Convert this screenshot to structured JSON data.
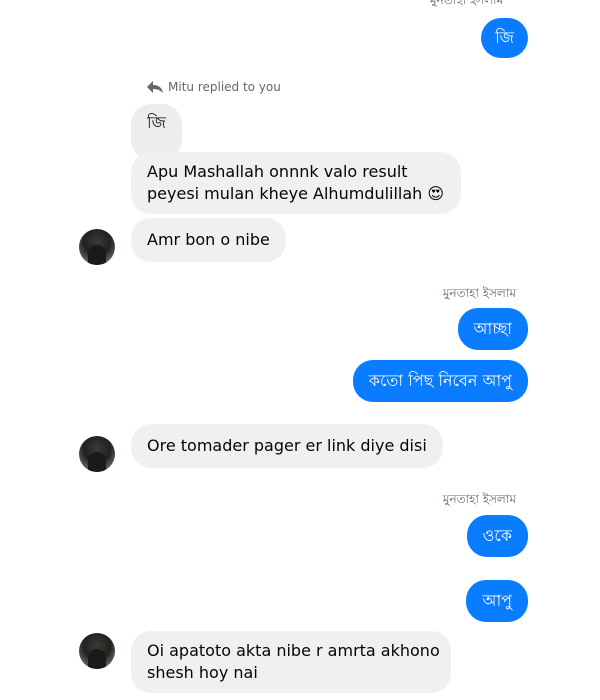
{
  "conversation": {
    "top_sender_cut": "মুনতাহা ইসলাম",
    "reply_context": {
      "label": "Mitu replied to you",
      "quoted_text": "জি"
    },
    "messages": [
      {
        "id": "m1",
        "side": "out",
        "text": "জি"
      },
      {
        "id": "m2",
        "side": "in",
        "line1": "Apu Mashallah onnnk valo result",
        "line2": "peyesi mulan kheye Alhumdulillah 😍"
      },
      {
        "id": "m3",
        "side": "in",
        "text": "Amr bon o nibe"
      },
      {
        "id": "m4",
        "side": "out",
        "sender": "মুনতাহা ইসলাম",
        "text": "আচ্ছা"
      },
      {
        "id": "m5",
        "side": "out",
        "text": "কতো পিছ নিবেন আপু"
      },
      {
        "id": "m6",
        "side": "in",
        "text": "Ore tomader pager er link diye disi"
      },
      {
        "id": "m7",
        "side": "out",
        "sender": "মুনতাহা ইসলাম",
        "text": "ওকে"
      },
      {
        "id": "m8",
        "side": "out",
        "text": "আপু"
      },
      {
        "id": "m9",
        "side": "in",
        "line1": "Oi apatoto akta nibe r amrta akhono",
        "line2": "shesh hoy nai"
      }
    ]
  },
  "colors": {
    "outgoing_bubble": "#0a7cff",
    "incoming_bubble": "#f0f0f0",
    "meta_text": "#65676b"
  },
  "icons": {
    "reply": "reply-arrow-icon",
    "avatar": "contact-avatar"
  }
}
